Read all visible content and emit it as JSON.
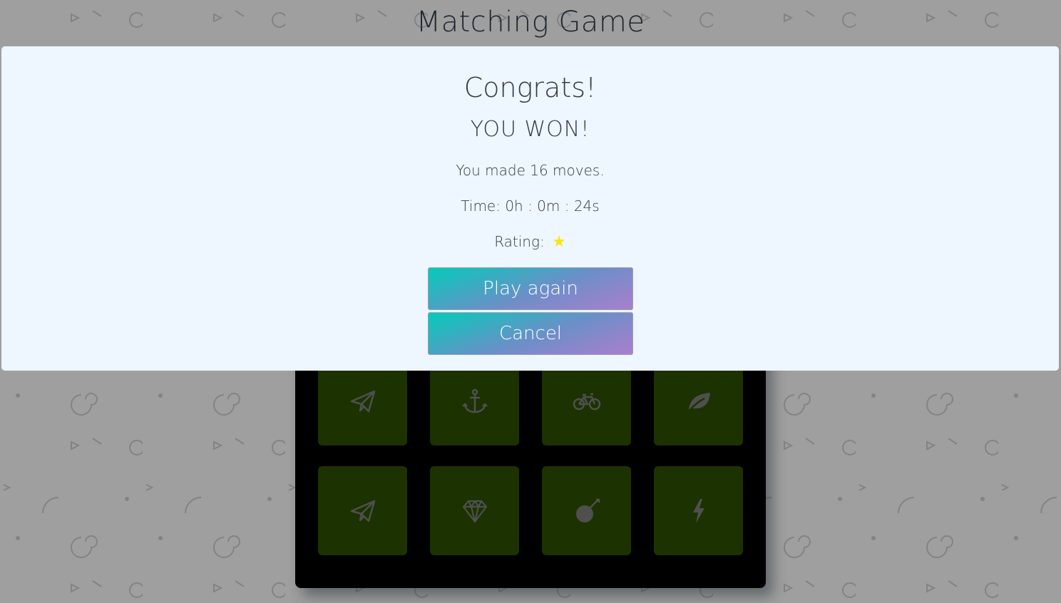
{
  "header": {
    "title": "Matching Game"
  },
  "deck": {
    "visible_cards": [
      {
        "icon": "paper-plane-icon",
        "state": "match"
      },
      {
        "icon": "anchor-icon",
        "state": "match"
      },
      {
        "icon": "bicycle-icon",
        "state": "match"
      },
      {
        "icon": "leaf-icon",
        "state": "match"
      },
      {
        "icon": "paper-plane-icon",
        "state": "match"
      },
      {
        "icon": "diamond-icon",
        "state": "match"
      },
      {
        "icon": "bomb-icon",
        "state": "match"
      },
      {
        "icon": "bolt-icon",
        "state": "match"
      }
    ],
    "card_color": "#2c4d00",
    "icon_color": "#7a7a7a"
  },
  "modal": {
    "title": "Congrats!",
    "subtitle": "YOU WON!",
    "moves_text": "You made 16 moves.",
    "time_text": "Time: 0h : 0m : 24s",
    "rating_label": "Rating:",
    "rating_stars": 1,
    "rating_icon": "star-icon",
    "star_color": "#f5e61a",
    "play_again_label": "Play again",
    "cancel_label": "Cancel"
  }
}
